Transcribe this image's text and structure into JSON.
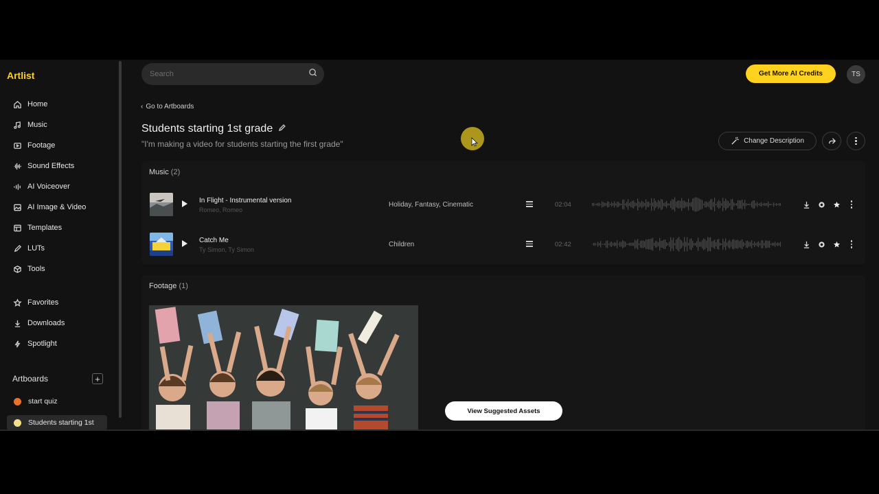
{
  "brand": {
    "logo": "Artlist",
    "accent": "#ffd21f"
  },
  "sidebar": {
    "nav": [
      {
        "label": "Home",
        "icon": "home-icon"
      },
      {
        "label": "Music",
        "icon": "music-note-icon"
      },
      {
        "label": "Footage",
        "icon": "film-icon"
      },
      {
        "label": "Sound Effects",
        "icon": "sound-wave-icon"
      },
      {
        "label": "AI Voiceover",
        "icon": "voice-bars-icon"
      },
      {
        "label": "AI Image & Video",
        "icon": "image-icon"
      },
      {
        "label": "Templates",
        "icon": "template-icon"
      },
      {
        "label": "LUTs",
        "icon": "pen-icon"
      },
      {
        "label": "Tools",
        "icon": "box-icon"
      }
    ],
    "secondary": [
      {
        "label": "Favorites",
        "icon": "star-icon"
      },
      {
        "label": "Downloads",
        "icon": "download-icon"
      },
      {
        "label": "Spotlight",
        "icon": "spotlight-icon"
      }
    ],
    "artboards": {
      "heading": "Artboards",
      "add_icon": "plus-icon",
      "items": [
        {
          "label": "start quiz",
          "color": "#e8722c"
        },
        {
          "label": "Students starting 1st",
          "color": "#f4e08a"
        }
      ]
    }
  },
  "topbar": {
    "search_placeholder": "Search",
    "credits_label": "Get More AI Credits",
    "avatar_initials": "TS"
  },
  "header": {
    "back_label": "Go to Artboards",
    "title": "Students starting 1st grade",
    "description": "\"I'm making a video for students starting the first grade\"",
    "change_description_label": "Change Description"
  },
  "music": {
    "heading": "Music",
    "count": "(2)",
    "tracks": [
      {
        "title": "In Flight - Instrumental version",
        "artist": "Romeo, Romeo",
        "tags": "Holiday, Fantasy, Cinematic",
        "duration": "02:04"
      },
      {
        "title": "Catch Me",
        "artist": "Ty Simon, Ty Simon",
        "tags": "Children",
        "duration": "02:42"
      }
    ]
  },
  "footage": {
    "heading": "Footage",
    "count": "(1)"
  },
  "suggest_label": "View Suggested Assets"
}
